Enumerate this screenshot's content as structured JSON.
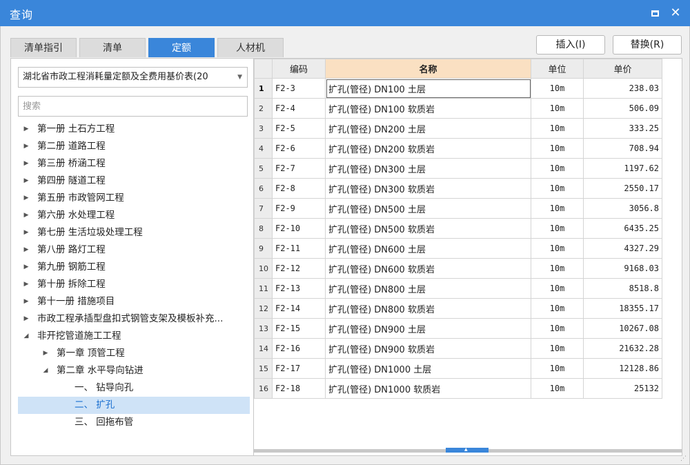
{
  "window": {
    "title": "查询"
  },
  "tabs": [
    {
      "label": "清单指引"
    },
    {
      "label": "清单"
    },
    {
      "label": "定额"
    },
    {
      "label": "人材机"
    }
  ],
  "actions": {
    "insert": "插入(I)",
    "replace": "替换(R)"
  },
  "left": {
    "select_value": "湖北省市政工程消耗量定额及全费用基价表(20",
    "search_placeholder": "搜索",
    "tree": [
      {
        "label": "第一册 土石方工程",
        "arrow": "▶",
        "level": 0
      },
      {
        "label": "第二册 道路工程",
        "arrow": "▶",
        "level": 0
      },
      {
        "label": "第三册 桥涵工程",
        "arrow": "▶",
        "level": 0
      },
      {
        "label": "第四册 隧道工程",
        "arrow": "▶",
        "level": 0
      },
      {
        "label": "第五册 市政管网工程",
        "arrow": "▶",
        "level": 0
      },
      {
        "label": "第六册 水处理工程",
        "arrow": "▶",
        "level": 0
      },
      {
        "label": "第七册 生活垃圾处理工程",
        "arrow": "▶",
        "level": 0
      },
      {
        "label": "第八册 路灯工程",
        "arrow": "▶",
        "level": 0
      },
      {
        "label": "第九册 钢筋工程",
        "arrow": "▶",
        "level": 0
      },
      {
        "label": "第十册 拆除工程",
        "arrow": "▶",
        "level": 0
      },
      {
        "label": "第十一册 措施项目",
        "arrow": "▶",
        "level": 0
      },
      {
        "label": "市政工程承插型盘扣式钢管支架及模板补充...",
        "arrow": "▶",
        "level": 0
      },
      {
        "label": "非开挖管道施工工程",
        "arrow": "◢",
        "level": 0
      },
      {
        "label": "第一章 顶管工程",
        "arrow": "▶",
        "level": 1
      },
      {
        "label": "第二章 水平导向钻进",
        "arrow": "◢",
        "level": 1
      },
      {
        "label": "一、 钻导向孔",
        "arrow": "",
        "level": 2
      },
      {
        "label": "二、 扩孔",
        "arrow": "",
        "level": 2,
        "selected": true
      },
      {
        "label": "三、 回拖布管",
        "arrow": "",
        "level": 2
      }
    ]
  },
  "grid": {
    "headers": {
      "code": "编码",
      "name": "名称",
      "unit": "单位",
      "price": "单价"
    },
    "rows": [
      {
        "idx": "1",
        "code": "F2-3",
        "name": "扩孔(管径) DN100 土层",
        "unit": "10m",
        "price": "238.03"
      },
      {
        "idx": "2",
        "code": "F2-4",
        "name": "扩孔(管径) DN100 软质岩",
        "unit": "10m",
        "price": "506.09"
      },
      {
        "idx": "3",
        "code": "F2-5",
        "name": "扩孔(管径) DN200 土层",
        "unit": "10m",
        "price": "333.25"
      },
      {
        "idx": "4",
        "code": "F2-6",
        "name": "扩孔(管径) DN200 软质岩",
        "unit": "10m",
        "price": "708.94"
      },
      {
        "idx": "5",
        "code": "F2-7",
        "name": "扩孔(管径) DN300 土层",
        "unit": "10m",
        "price": "1197.62"
      },
      {
        "idx": "6",
        "code": "F2-8",
        "name": "扩孔(管径) DN300 软质岩",
        "unit": "10m",
        "price": "2550.17"
      },
      {
        "idx": "7",
        "code": "F2-9",
        "name": "扩孔(管径) DN500 土层",
        "unit": "10m",
        "price": "3056.8"
      },
      {
        "idx": "8",
        "code": "F2-10",
        "name": "扩孔(管径) DN500 软质岩",
        "unit": "10m",
        "price": "6435.25"
      },
      {
        "idx": "9",
        "code": "F2-11",
        "name": "扩孔(管径) DN600 土层",
        "unit": "10m",
        "price": "4327.29"
      },
      {
        "idx": "10",
        "code": "F2-12",
        "name": "扩孔(管径) DN600 软质岩",
        "unit": "10m",
        "price": "9168.03"
      },
      {
        "idx": "11",
        "code": "F2-13",
        "name": "扩孔(管径) DN800 土层",
        "unit": "10m",
        "price": "8518.8"
      },
      {
        "idx": "12",
        "code": "F2-14",
        "name": "扩孔(管径) DN800 软质岩",
        "unit": "10m",
        "price": "18355.17"
      },
      {
        "idx": "13",
        "code": "F2-15",
        "name": "扩孔(管径) DN900 土层",
        "unit": "10m",
        "price": "10267.08"
      },
      {
        "idx": "14",
        "code": "F2-16",
        "name": "扩孔(管径) DN900 软质岩",
        "unit": "10m",
        "price": "21632.28"
      },
      {
        "idx": "15",
        "code": "F2-17",
        "name": "扩孔(管径) DN1000 土层",
        "unit": "10m",
        "price": "12128.86"
      },
      {
        "idx": "16",
        "code": "F2-18",
        "name": "扩孔(管径) DN1000 软质岩",
        "unit": "10m",
        "price": "25132"
      }
    ]
  },
  "colors": {
    "accent": "#3a86da",
    "header_highlight": "#fae0c2",
    "selection": "#cfe3f7"
  }
}
